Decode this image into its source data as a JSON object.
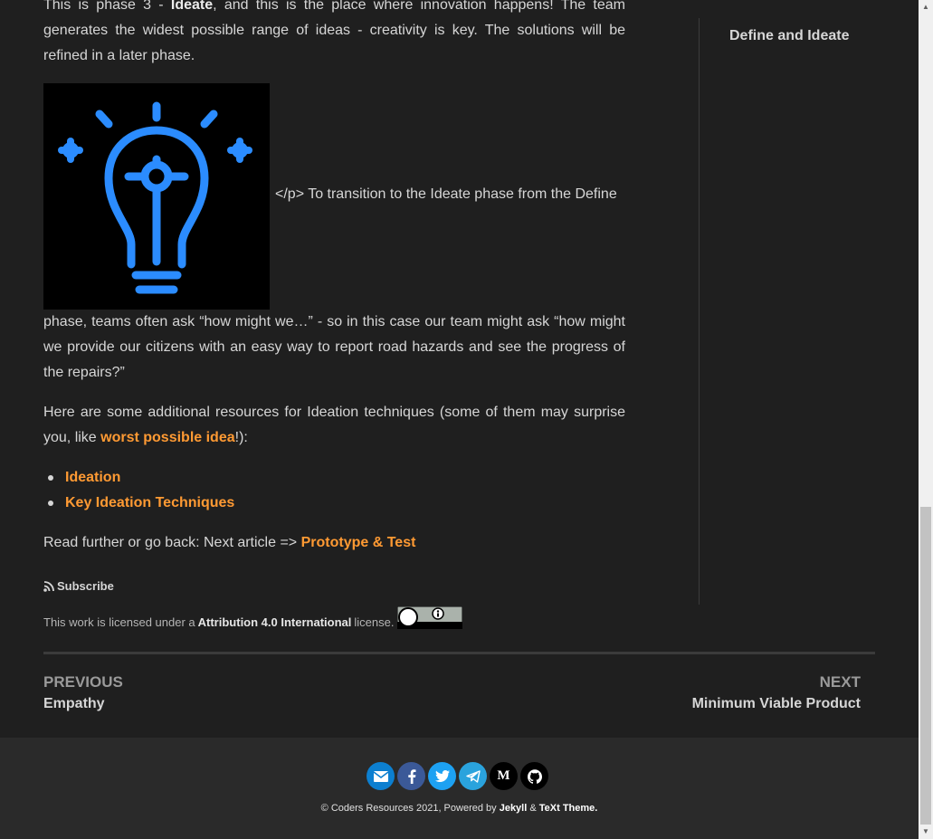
{
  "article": {
    "intro_pre": "This is phase 3 - ",
    "intro_bold": "Ideate",
    "intro_post": ", and this is the place where innovation happens! The team generates the widest possible range of ideas - creativity is key. The solutions will be refined in a later phase.",
    "img_text": "</p> To transition to the Ideate phase from the Define",
    "after_img": "phase, teams often ask “how might we…” - so in this case our team might ask “how might we provide our citizens with an easy way to report road hazards and see the progress of the repairs?”",
    "resources_pre": "Here are some additional resources for Ideation techniques (some of them may surprise you, like ",
    "resources_link": "worst possible idea",
    "resources_post": "!):",
    "list": [
      "Ideation",
      "Key Ideation Techniques"
    ],
    "next_pre": "Read further or go back: Next article => ",
    "next_link": "Prototype & Test"
  },
  "subscribe_label": "Subscribe",
  "license": {
    "pre": "This work is licensed under a",
    "name": "Attribution 4.0 International",
    "post": "license."
  },
  "aside": {
    "title": "Define and Ideate"
  },
  "pagination": {
    "prev_label": "PREVIOUS",
    "prev_title": "Empathy",
    "next_label": "NEXT",
    "next_title": "Minimum Viable Product"
  },
  "footer": {
    "copyright_pre": "© Coders Resources 2021, Powered by ",
    "jekyll": "Jekyll",
    "amp": " & ",
    "theme": "TeXt Theme",
    "period": "."
  },
  "socials": [
    {
      "icon": "email-icon",
      "color": "#0c7fd0"
    },
    {
      "icon": "facebook-icon",
      "color": "#3b5998"
    },
    {
      "icon": "twitter-icon",
      "color": "#1da1f2"
    },
    {
      "icon": "telegram-icon",
      "color": "#2aa3dd"
    },
    {
      "icon": "medium-icon",
      "color": "#000000"
    },
    {
      "icon": "github-icon",
      "color": "#000000"
    }
  ],
  "colors": {
    "link": "#ff9a33",
    "background": "#1f1f1f",
    "footer": "#2a2a2a",
    "bulb": "#2b8cff"
  }
}
